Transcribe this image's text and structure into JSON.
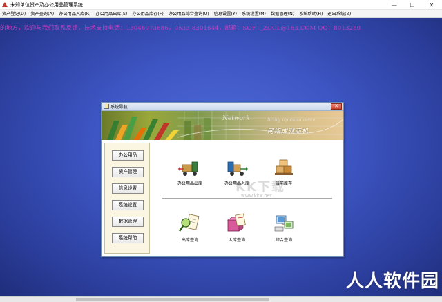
{
  "window": {
    "title": "未知单位资产及办公用品管理系统",
    "minimize_glyph": "—",
    "maximize_glyph": "☐",
    "close_glyph": "✕"
  },
  "menu": [
    "资产登记(D)",
    "资产查询(A)",
    "办公用品入库(R)",
    "办公用品出库(S)",
    "办公用品库存(F)",
    "办公用品综合查询(U)",
    "信息设置(Y)",
    "系统设置(M)",
    "数据管理(N)",
    "系统帮助(H)",
    "退出系统(Z)"
  ],
  "marquee": "的地方，欢迎与我们联系反馈，技术支持电话：13046073686，0533-8301644，邮箱：SOFT_ZCGL@163.COM QQ：8013280",
  "dialog": {
    "title": "系统导航",
    "close_glyph": "✕",
    "banner": {
      "network_text": "Network",
      "commerce_text": "bring up commerce",
      "slogan": "网络成就商机"
    },
    "watermark": {
      "kk": "KK下载",
      "url": "www.kkx.net"
    },
    "nav_buttons": [
      "办公用品",
      "资产管理",
      "信息设置",
      "系统设置",
      "数据管理",
      "系统帮助"
    ],
    "tiles_top": [
      "办公用品出库",
      "办公用品入库",
      "当前库存"
    ],
    "tiles_bottom": [
      "出库查询",
      "入库查询",
      "综合查询"
    ]
  },
  "corner_watermark": "人人软件园",
  "colors": {
    "desktop_blue": "#3e56c4",
    "marquee": "#c040c0",
    "dialog_border": "#6d8fb8"
  }
}
